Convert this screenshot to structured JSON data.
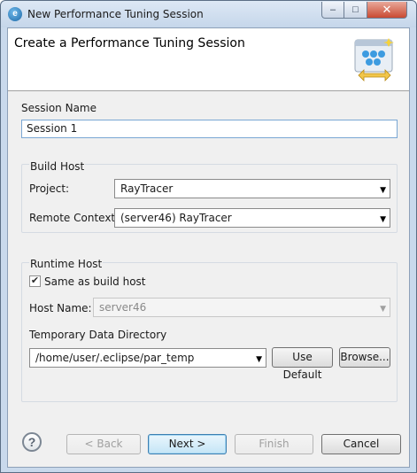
{
  "window": {
    "title": "New Performance Tuning Session",
    "minimize_glyph": "–",
    "maximize_glyph": "□",
    "close_glyph": "✕",
    "app_icon_glyph": "e"
  },
  "header": {
    "title": "Create a Performance Tuning Session",
    "banner_icon": "wizard-banner-icon"
  },
  "session": {
    "label": "Session Name",
    "value": "Session 1"
  },
  "build_host": {
    "group_label": "Build Host",
    "project_label": "Project:",
    "project_value": "RayTracer",
    "remote_context_label": "Remote Context:",
    "remote_context_value": "(server46) RayTracer"
  },
  "runtime_host": {
    "group_label": "Runtime Host",
    "same_as_build_checked": true,
    "same_as_build_label": "Same as build host",
    "host_name_label": "Host Name:",
    "host_name_value": "server46",
    "temp_dir_label": "Temporary Data Directory",
    "temp_dir_value": "/home/user/.eclipse/par_temp",
    "use_default_label": "Use Default",
    "browse_label": "Browse..."
  },
  "footer": {
    "help_glyph": "?",
    "back_label": "< Back",
    "next_label": "Next >",
    "finish_label": "Finish",
    "cancel_label": "Cancel"
  },
  "dropdown_arrow": "▼",
  "check_glyph": "✔",
  "colors": {
    "titlebar": "#c9d9ec",
    "client_bg": "#f0f0f0",
    "focus_border": "#7aa7d4",
    "default_button": "#c4e5f6"
  }
}
